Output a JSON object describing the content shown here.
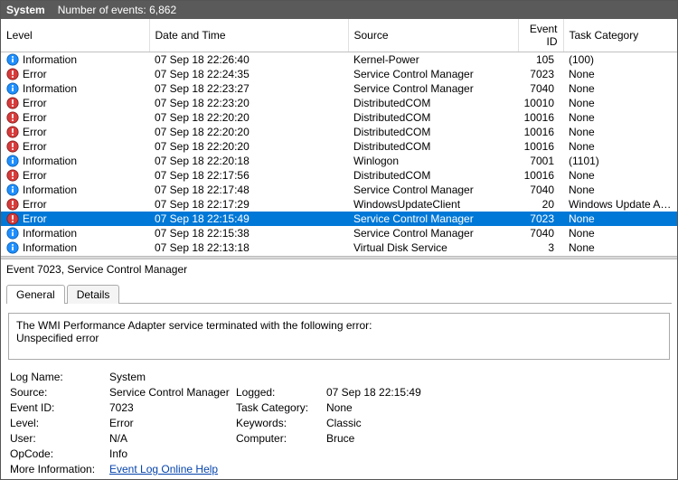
{
  "header": {
    "title": "System",
    "count_label": "Number of events: 6,862"
  },
  "columns": {
    "level": "Level",
    "datetime": "Date and Time",
    "source": "Source",
    "event_id": "Event ID",
    "task_cat": "Task Category"
  },
  "icons": {
    "Error": "error-icon",
    "Information": "info-icon"
  },
  "rows": [
    {
      "level": "Information",
      "dt": "07 Sep 18 22:26:40",
      "src": "Kernel-Power",
      "eid": "105",
      "cat": "(100)"
    },
    {
      "level": "Error",
      "dt": "07 Sep 18 22:24:35",
      "src": "Service Control Manager",
      "eid": "7023",
      "cat": "None"
    },
    {
      "level": "Information",
      "dt": "07 Sep 18 22:23:27",
      "src": "Service Control Manager",
      "eid": "7040",
      "cat": "None"
    },
    {
      "level": "Error",
      "dt": "07 Sep 18 22:23:20",
      "src": "DistributedCOM",
      "eid": "10010",
      "cat": "None"
    },
    {
      "level": "Error",
      "dt": "07 Sep 18 22:20:20",
      "src": "DistributedCOM",
      "eid": "10016",
      "cat": "None"
    },
    {
      "level": "Error",
      "dt": "07 Sep 18 22:20:20",
      "src": "DistributedCOM",
      "eid": "10016",
      "cat": "None"
    },
    {
      "level": "Error",
      "dt": "07 Sep 18 22:20:20",
      "src": "DistributedCOM",
      "eid": "10016",
      "cat": "None"
    },
    {
      "level": "Information",
      "dt": "07 Sep 18 22:20:18",
      "src": "Winlogon",
      "eid": "7001",
      "cat": "(1101)"
    },
    {
      "level": "Error",
      "dt": "07 Sep 18 22:17:56",
      "src": "DistributedCOM",
      "eid": "10016",
      "cat": "None"
    },
    {
      "level": "Information",
      "dt": "07 Sep 18 22:17:48",
      "src": "Service Control Manager",
      "eid": "7040",
      "cat": "None"
    },
    {
      "level": "Error",
      "dt": "07 Sep 18 22:17:29",
      "src": "WindowsUpdateClient",
      "eid": "20",
      "cat": "Windows Update Agent"
    },
    {
      "level": "Error",
      "dt": "07 Sep 18 22:15:49",
      "src": "Service Control Manager",
      "eid": "7023",
      "cat": "None",
      "selected": true
    },
    {
      "level": "Information",
      "dt": "07 Sep 18 22:15:38",
      "src": "Service Control Manager",
      "eid": "7040",
      "cat": "None"
    },
    {
      "level": "Information",
      "dt": "07 Sep 18 22:13:18",
      "src": "Virtual Disk Service",
      "eid": "3",
      "cat": "None"
    }
  ],
  "detail": {
    "title": "Event 7023, Service Control Manager",
    "tabs": {
      "general": "General",
      "details": "Details"
    },
    "message_line1": "The WMI Performance Adapter service terminated with the following error:",
    "message_line2": "Unspecified error",
    "labels": {
      "log_name": "Log Name:",
      "source": "Source:",
      "event_id": "Event ID:",
      "level": "Level:",
      "user": "User:",
      "opcode": "OpCode:",
      "more_info": "More Information:",
      "logged": "Logged:",
      "task_cat": "Task Category:",
      "keywords": "Keywords:",
      "computer": "Computer:"
    },
    "values": {
      "log_name": "System",
      "source": "Service Control Manager",
      "event_id": "7023",
      "level": "Error",
      "user": "N/A",
      "opcode": "Info",
      "more_info": "Event Log Online Help",
      "logged": "07 Sep 18 22:15:49",
      "task_cat": "None",
      "keywords": "Classic",
      "computer": "Bruce"
    }
  }
}
